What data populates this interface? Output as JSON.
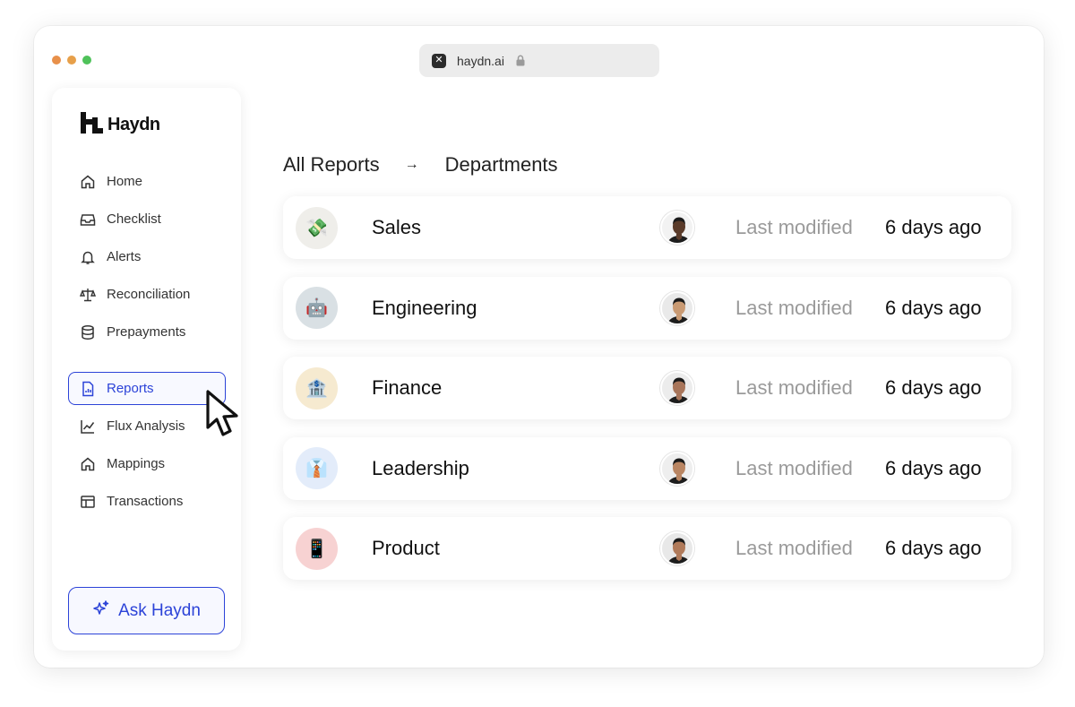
{
  "browser": {
    "url": "haydn.ai",
    "favicon": "x-mark-icon",
    "lock_icon": "lock-icon"
  },
  "sidebar": {
    "brand": "Haydn",
    "items": [
      {
        "label": "Home",
        "icon": "home-icon"
      },
      {
        "label": "Checklist",
        "icon": "inbox-tray-icon"
      },
      {
        "label": "Alerts",
        "icon": "bell-icon"
      },
      {
        "label": "Reconciliation",
        "icon": "scale-icon"
      },
      {
        "label": "Prepayments",
        "icon": "database-icon"
      },
      {
        "label": "Reports",
        "icon": "report-file-icon",
        "active": true
      },
      {
        "label": "Flux Analysis",
        "icon": "line-chart-icon"
      },
      {
        "label": "Mappings",
        "icon": "home-icon"
      },
      {
        "label": "Transactions",
        "icon": "table-icon"
      }
    ],
    "ask_button": "Ask Haydn"
  },
  "breadcrumb": {
    "root": "All Reports",
    "separator": "→",
    "current": "Departments"
  },
  "departments": [
    {
      "name": "Sales",
      "emoji": "💸",
      "bg": "#efeeea",
      "modified_label": "Last modified",
      "modified_value": "6 days ago",
      "avatar_skin": "#5a3b2a",
      "avatar_bg": "#f2f2f2"
    },
    {
      "name": "Engineering",
      "emoji": "🤖",
      "bg": "#d9e0e4",
      "modified_label": "Last modified",
      "modified_value": "6 days ago",
      "avatar_skin": "#c99a73",
      "avatar_bg": "#e9e9e9"
    },
    {
      "name": "Finance",
      "emoji": "🏦",
      "bg": "#f6ead0",
      "modified_label": "Last modified",
      "modified_value": "6 days ago",
      "avatar_skin": "#a8755a",
      "avatar_bg": "#ececec"
    },
    {
      "name": "Leadership",
      "emoji": "👔",
      "bg": "#e3ecfa",
      "modified_label": "Last modified",
      "modified_value": "6 days ago",
      "avatar_skin": "#b98562",
      "avatar_bg": "#eeeeee"
    },
    {
      "name": "Product",
      "emoji": "📱",
      "bg": "#f7d2d2",
      "modified_label": "Last modified",
      "modified_value": "6 days ago",
      "avatar_skin": "#b07a5a",
      "avatar_bg": "#e8e8e8"
    }
  ],
  "colors": {
    "accent": "#2c43d8",
    "muted_text": "#9a9a9a"
  }
}
